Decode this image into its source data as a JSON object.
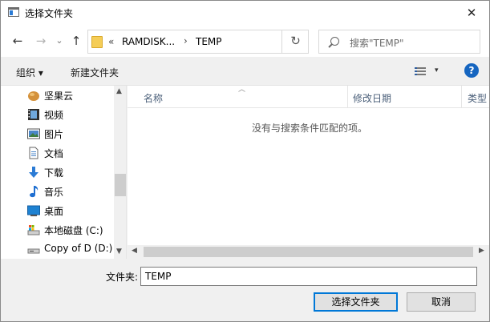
{
  "window": {
    "title": "选择文件夹",
    "close": "✕"
  },
  "nav": {
    "back": "←",
    "forward": "→",
    "recent": "⌄",
    "up": "↑",
    "address": {
      "overflow": "«",
      "segments": [
        "RAMDISK...",
        "TEMP"
      ],
      "separator": "›"
    },
    "refresh": "↻",
    "search_placeholder": "搜索\"TEMP\""
  },
  "toolbar": {
    "organize": "组织 ▾",
    "new_folder": "新建文件夹",
    "view_menu": "▾",
    "help": "?"
  },
  "sidebar": {
    "items": [
      {
        "label": "坚果云",
        "icon": "nut-cloud-icon"
      },
      {
        "label": "视频",
        "icon": "video-icon"
      },
      {
        "label": "图片",
        "icon": "pictures-icon"
      },
      {
        "label": "文档",
        "icon": "documents-icon"
      },
      {
        "label": "下载",
        "icon": "download-icon"
      },
      {
        "label": "音乐",
        "icon": "music-icon"
      },
      {
        "label": "桌面",
        "icon": "desktop-icon"
      },
      {
        "label": "本地磁盘 (C:)",
        "icon": "drive-c-icon"
      },
      {
        "label": "Copy of D (D:)",
        "icon": "drive-d-icon"
      }
    ]
  },
  "list": {
    "columns": [
      "名称",
      "修改日期",
      "类型"
    ],
    "empty_message": "没有与搜索条件匹配的项。"
  },
  "footer": {
    "folder_label": "文件夹:",
    "folder_value": "TEMP",
    "select_button": "选择文件夹",
    "cancel_button": "取消"
  },
  "colors": {
    "accent": "#0078d7",
    "help": "#1565c0",
    "folder": "#f5cd57"
  }
}
